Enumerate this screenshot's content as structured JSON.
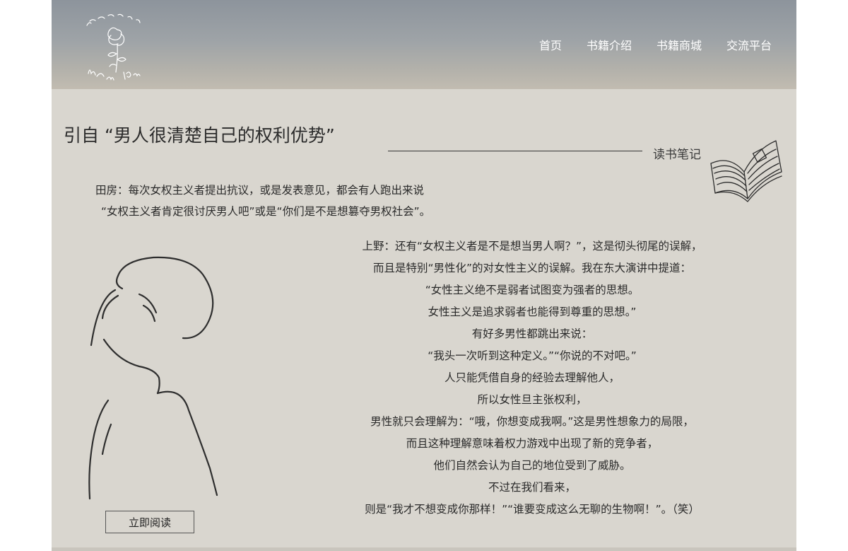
{
  "nav": {
    "items": [
      {
        "label": "首页"
      },
      {
        "label": "书籍介绍"
      },
      {
        "label": "书籍商城"
      },
      {
        "label": "交流平台"
      }
    ]
  },
  "logo": {
    "icon": "rose-logo-icon"
  },
  "article": {
    "title": "引自 “男人很清楚自己的权利优势”",
    "notes_label": "读书笔记",
    "intro": [
      "田房：每次女权主义者提出抗议，或是发表意见，都会有人跑出来说",
      "“女权主义者肯定很讨厌男人吧”或是“你们是不是想篡夺男权社会”。"
    ],
    "quote": [
      "上野：还有“女权主义者是不是想当男人啊？”，这是彻头彻尾的误解，",
      "而且是特别“男性化”的对女性主义的误解。我在东大演讲中提道：",
      "“女性主义绝不是弱者试图变为强者的思想。",
      "女性主义是追求弱者也能得到尊重的思想。”",
      "有好多男性都跳出来说：",
      "“我头一次听到这种定义。”“你说的不对吧。”",
      "人只能凭借自身的经验去理解他人，",
      "所以女性旦主张权利，",
      "男性就只会理解为：“哦，你想变成我啊。”这是男性想象力的局限，",
      "而且这种理解意味着权力游戏中出现了新的竞争者，",
      "他们自然会认为自己的地位受到了威胁。",
      "不过在我们看来，",
      "则是“我才不想变成你那样！”“谁要变成这么无聊的生物啊！”。（笑）"
    ],
    "read_button": "立即阅读"
  },
  "colors": {
    "page_background": "#d9d6cf",
    "header_top": "#8d949c",
    "header_bottom": "#c2bcb1",
    "nav_text": "#ffffff",
    "body_text": "#2a2a2a"
  },
  "icons": [
    "rose-logo-icon",
    "open-book-icon",
    "woman-silhouette-illustration"
  ]
}
